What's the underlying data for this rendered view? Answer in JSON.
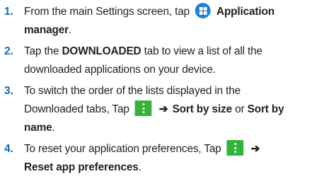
{
  "steps": [
    {
      "number": "1.",
      "line1_pre": "From the main Settings screen, tap",
      "line1_bold": "Application",
      "line2_bold": "manager",
      "line2_post": ".",
      "icon": "application-manager-icon"
    },
    {
      "number": "2.",
      "line1_pre": "Tap the",
      "line1_bold": "DOWNLOADED",
      "line1_post": "tab to view a list of all the",
      "line2": "downloaded applications on your device."
    },
    {
      "number": "3.",
      "line1": "To switch the order of the lists displayed in the",
      "line2_pre": "Downloaded tabs, Tap",
      "arrow": "➔",
      "line2_bold1": "Sort by size",
      "line2_mid": "or",
      "line2_bold2": "Sort by",
      "line3_bold": "name",
      "line3_post": ".",
      "icon": "menu-icon"
    },
    {
      "number": "4.",
      "line1_pre": "To reset your application preferences, Tap",
      "arrow": "➔",
      "line2_bold": "Reset app preferences",
      "line2_post": ".",
      "icon": "menu-icon"
    }
  ],
  "colors": {
    "number": "#0a6bb5",
    "app_icon": "#1f7fd1",
    "menu_icon": "#34b33a",
    "text": "#231f20"
  }
}
